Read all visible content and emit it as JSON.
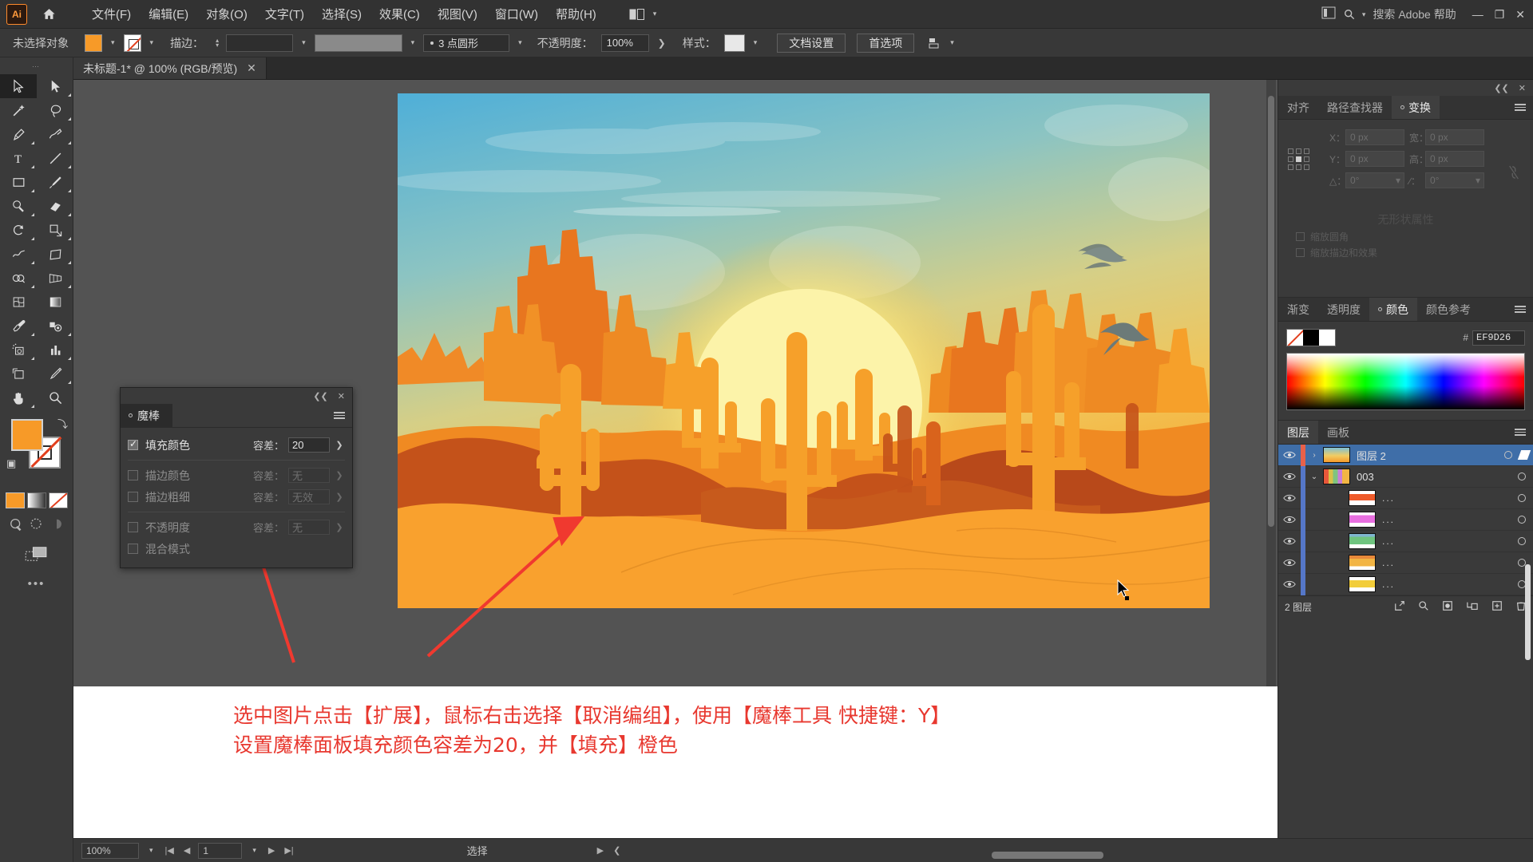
{
  "app": {
    "logo": "Ai",
    "menus": [
      "文件(F)",
      "编辑(E)",
      "对象(O)",
      "文字(T)",
      "选择(S)",
      "效果(C)",
      "视图(V)",
      "窗口(W)",
      "帮助(H)"
    ],
    "search_placeholder": "搜索 Adobe 帮助"
  },
  "controlbar": {
    "selection_status": "未选择对象",
    "fill_color": "#F79A28",
    "stroke_label": "描边：",
    "stroke_weight": "",
    "profile": "3 点圆形",
    "opacity_label": "不透明度：",
    "opacity_value": "100%",
    "style_label": "样式：",
    "document_setup": "文档设置",
    "preferences": "首选项"
  },
  "document": {
    "tab_title": "未标题-1* @ 100% (RGB/预览)",
    "close": "✕"
  },
  "toolbar": {
    "tools": [
      "selection-tool",
      "direct-selection-tool",
      "magic-wand-tool",
      "lasso-tool",
      "pen-tool",
      "curvature-tool",
      "type-tool",
      "line-tool",
      "rectangle-tool",
      "paintbrush-tool",
      "shaper-tool",
      "eraser-tool",
      "rotate-tool",
      "scale-tool",
      "width-tool",
      "free-transform-tool",
      "shape-builder-tool",
      "perspective-grid-tool",
      "mesh-tool",
      "gradient-tool",
      "eyedropper-tool",
      "blend-tool",
      "symbol-sprayer-tool",
      "column-graph-tool",
      "artboard-tool",
      "slice-tool",
      "hand-tool",
      "zoom-tool"
    ],
    "fill_color": "#F79A28",
    "stroke_color": "none",
    "more_tools": "•••"
  },
  "wand_panel": {
    "title": "魔棒",
    "rows": [
      {
        "label": "填充颜色",
        "checked": true,
        "enabled": true,
        "tol_label": "容差：",
        "tol_value": "20"
      },
      {
        "label": "描边颜色",
        "checked": false,
        "enabled": false,
        "tol_label": "容差：",
        "tol_value": "无"
      },
      {
        "label": "描边粗细",
        "checked": false,
        "enabled": false,
        "tol_label": "容差：",
        "tol_value": "无效"
      },
      {
        "label": "不透明度",
        "checked": false,
        "enabled": false,
        "tol_label": "容差：",
        "tol_value": "无"
      },
      {
        "label": "混合模式",
        "checked": false,
        "enabled": false,
        "tol_label": "",
        "tol_value": ""
      }
    ]
  },
  "transform_panel": {
    "tabs": [
      "对齐",
      "路径查找器",
      "变换"
    ],
    "active_tab": "变换",
    "x_label": "X：",
    "x_value": "0 px",
    "y_label": "Y：",
    "y_value": "0 px",
    "w_label": "宽：",
    "w_value": "0 px",
    "h_label": "高：",
    "h_value": "0 px",
    "angle_label": "△：",
    "angle_value": "0°",
    "shear_label": "∕：",
    "shear_value": "0°",
    "empty_text": "无形状属性",
    "chk_scale_corners": "缩放圆角",
    "chk_scale_strokes": "缩放描边和效果"
  },
  "color_panel": {
    "tabs": [
      "渐变",
      "透明度",
      "颜色",
      "颜色参考"
    ],
    "active_tab": "颜色",
    "hash": "#",
    "hex": "EF9D26",
    "fill_color": "#EF9D26"
  },
  "layers_panel": {
    "tabs": [
      "图层",
      "画板"
    ],
    "active_tab": "图层",
    "rows": [
      {
        "name": "图层 2",
        "selected": true,
        "indent": 0,
        "expander": "›",
        "thumb": "artwork",
        "bar": "#E8614A"
      },
      {
        "name": "003",
        "selected": false,
        "indent": 0,
        "expander": "⌄",
        "thumb": "group",
        "bar": "#5577C8"
      },
      {
        "name": "...",
        "selected": false,
        "indent": 1,
        "expander": "",
        "thumb": "red",
        "bar": "#5577C8"
      },
      {
        "name": "...",
        "selected": false,
        "indent": 1,
        "expander": "",
        "thumb": "magenta",
        "bar": "#5577C8"
      },
      {
        "name": "...",
        "selected": false,
        "indent": 1,
        "expander": "",
        "thumb": "green",
        "bar": "#5577C8"
      },
      {
        "name": "...",
        "selected": false,
        "indent": 1,
        "expander": "",
        "thumb": "orange",
        "bar": "#5577C8"
      },
      {
        "name": "...",
        "selected": false,
        "indent": 1,
        "expander": "",
        "thumb": "yellow",
        "bar": "#5577C8"
      }
    ],
    "footer_count": "2 图层"
  },
  "statusbar": {
    "zoom": "100%",
    "page": "1",
    "tool": "选择"
  },
  "annotation": {
    "line1": "选中图片点击【扩展】，鼠标右击选择【取消编组】，使用【魔棒工具 快捷键：Y】",
    "line2": "设置魔棒面板填充颜色容差为20，并【填充】橙色",
    "color": "#E8382F"
  },
  "artwork": {
    "title": "desert-sunset-illustration",
    "sky_top": "#5FB4D8",
    "sky_mid": "#E8D06A",
    "sun": "#FCF2A8",
    "sand": "#F9A12E",
    "mesa_dark": "#C4521A",
    "cactus": "#F6A02A"
  }
}
